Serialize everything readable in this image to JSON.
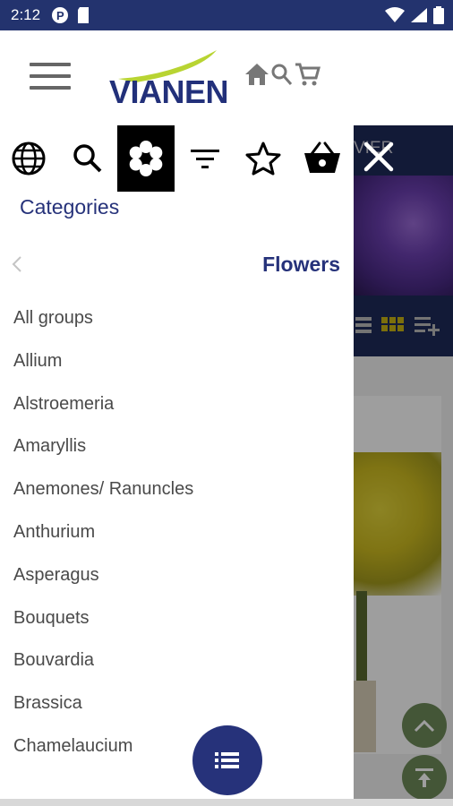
{
  "status_bar": {
    "time": "2:12",
    "icons": [
      "p-badge-icon",
      "sd-card-icon",
      "wifi-icon",
      "signal-icon",
      "battery-icon"
    ]
  },
  "header": {
    "logo_text": "VIANEN",
    "icons": [
      "menu-icon",
      "home-icon",
      "search-icon",
      "cart-icon"
    ]
  },
  "drawer": {
    "toolbar_icons": [
      "globe-icon",
      "search-icon",
      "flower-icon",
      "filter-icon",
      "star-icon",
      "basket-icon"
    ],
    "active_icon": "flower-icon",
    "categories_label": "Categories",
    "section_title": "Flowers",
    "items": [
      "All groups",
      "Allium",
      "Alstroemeria",
      "Amaryllis",
      "Anemones/ Ranuncles",
      "Anthurium",
      "Asperagus",
      "Bouquets",
      "Bouvardia",
      "Brassica",
      "Chamelaucium"
    ]
  },
  "background": {
    "banner_text": "VIER"
  },
  "colors": {
    "navy": "#26327a",
    "status_bar": "#23336e",
    "logo_swoosh": "#b8d432",
    "active_bg": "#000000",
    "item_text": "#4a4a4a"
  }
}
